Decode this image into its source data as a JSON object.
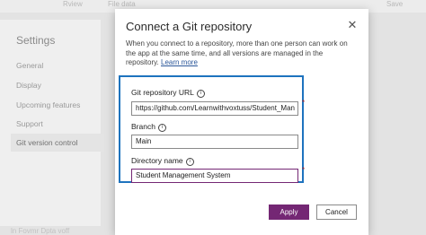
{
  "background": {
    "toolbar_items": [
      "Rview",
      "File data",
      "Save"
    ],
    "settings": {
      "title": "Settings",
      "items": [
        {
          "label": "General"
        },
        {
          "label": "Display"
        },
        {
          "label": "Upcoming features"
        },
        {
          "label": "Support"
        },
        {
          "label": "Git version control"
        }
      ]
    },
    "footer_text": "ln Fovmr Dpta voff"
  },
  "modal": {
    "title": "Connect a Git repository",
    "close_symbol": "✕",
    "description": "When you connect to a repository, more than one person can work on the app at the same time, and all versions are managed in the repository.",
    "learn_more": "Learn more",
    "fields": {
      "repo_url": {
        "label": "Git repository URL",
        "value": "https://github.com/Learnwithvoxtuss/Student_Man",
        "required": "*"
      },
      "branch": {
        "label": "Branch",
        "value": "Main"
      },
      "directory": {
        "label": "Directory name",
        "value": "Student Management System",
        "required": "*"
      }
    },
    "info_symbol": "i",
    "apply_label": "Apply",
    "cancel_label": "Cancel"
  }
}
